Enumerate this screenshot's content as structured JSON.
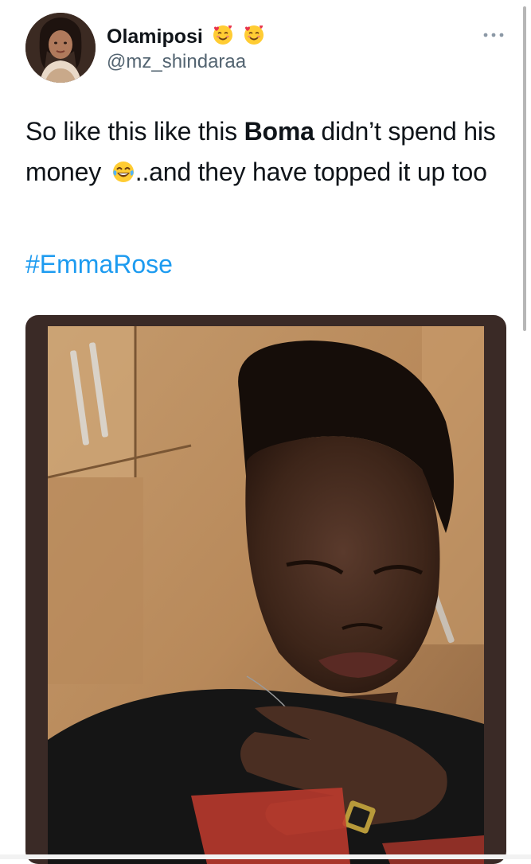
{
  "tweet": {
    "author": {
      "display_name": "Olamiposi",
      "name_emojis": [
        "smiling-face-with-hearts",
        "smiling-face-with-hearts"
      ],
      "handle": "@mz_shindaraa"
    },
    "text": {
      "part1": "So like this like this ",
      "bold": "Boma",
      "part2": " didn’t spend his money ",
      "emoji": "face-with-tears-of-joy",
      "part3": "..and they have topped it up too"
    },
    "hashtag": "#EmmaRose",
    "media": {
      "description_icon": "photo"
    }
  },
  "colors": {
    "text": "#0f1419",
    "secondary": "#536471",
    "link": "#1d9bf0",
    "media_frame": "#3a2a26"
  }
}
